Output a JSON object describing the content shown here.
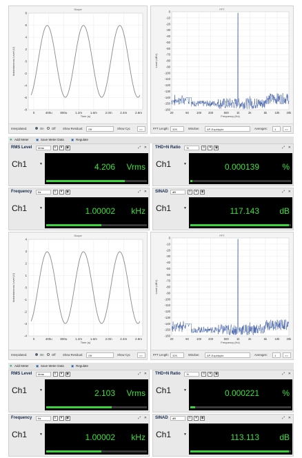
{
  "panels": [
    {
      "scope": {
        "title": "Scope",
        "ylabel": "Instantaneous Level (V)",
        "xlabel": "Time (s)",
        "yticks": [
          "8",
          "6",
          "4",
          "2",
          "0",
          "-2",
          "-4",
          "-6",
          "-8"
        ],
        "xticks": [
          "0",
          "400u",
          "800u",
          "1.2m",
          "1.6m",
          "2.0m",
          "2.4m",
          "2.8m"
        ],
        "amplitude": 5.95,
        "controls": {
          "interpolated": "Interpolated:",
          "on": "On",
          "off": "Off",
          "show_residual": "Show Residual:",
          "residual_value": "Off",
          "show_cyc": "Show Cyc",
          "more": ">>"
        }
      },
      "fft": {
        "title": "FFT",
        "ylabel": "Level (dBV)",
        "xlabel": "Frequency (Hz)",
        "yticks": [
          "0",
          "-10",
          "-20",
          "-30",
          "-40",
          "-50",
          "-60",
          "-70",
          "-80",
          "-90",
          "-100",
          "-110",
          "-120",
          "-130",
          "-140",
          "-150",
          "-160"
        ],
        "xticks": [
          "20",
          "50",
          "100",
          "200",
          "500",
          "1k",
          "2k",
          "5k",
          "10k",
          "20k"
        ],
        "controls": {
          "length_label": "FFT Length:",
          "length": "32K",
          "window_label": "Window:",
          "window": "AP-Equiripple",
          "avg_label": "Averages:",
          "avg": "1",
          "more": ">>"
        }
      },
      "toolbar": {
        "add": "Add Meter",
        "save": "Save Meter Data",
        "regulate": "Regulate"
      },
      "meters": [
        {
          "title": "RMS Level",
          "unit_select": "Vrms",
          "channel": "Ch1",
          "value": "4.206",
          "unit": "Vrms",
          "bar_fraction": 0.78
        },
        {
          "title": "THD+N Ratio",
          "unit_select": "%",
          "channel": "Ch1",
          "value": "0.000139",
          "unit": "%",
          "bar_fraction": 0.02
        },
        {
          "title": "Frequency",
          "unit_select": "Hz",
          "channel": "Ch1",
          "value": "1.00002",
          "unit": "kHz",
          "bar_fraction": 0.55
        },
        {
          "title": "SINAD",
          "unit_select": "dB",
          "channel": "Ch1",
          "value": "117.143",
          "unit": "dB",
          "bar_fraction": 0.98
        }
      ]
    },
    {
      "scope": {
        "title": "Scope",
        "ylabel": "Instantaneous Level (V)",
        "xlabel": "Time (s)",
        "yticks": [
          "4",
          "3",
          "2",
          "1",
          "0",
          "-1",
          "-2",
          "-3",
          "-4"
        ],
        "xticks": [
          "0",
          "400u",
          "800u",
          "1.2m",
          "1.6m",
          "2.0m",
          "2.4m",
          "2.8m"
        ],
        "amplitude": 2.97,
        "controls": {
          "interpolated": "Interpolated:",
          "on": "On",
          "off": "Off",
          "show_residual": "Show Residual:",
          "residual_value": "Off",
          "show_cyc": "Show Cyc",
          "more": ">>"
        }
      },
      "fft": {
        "title": "FFT",
        "ylabel": "Level (dBV)",
        "xlabel": "Frequency (Hz)",
        "yticks": [
          "0",
          "-10",
          "-20",
          "-30",
          "-40",
          "-50",
          "-60",
          "-70",
          "-80",
          "-90",
          "-100",
          "-110",
          "-120",
          "-130",
          "-140",
          "-150",
          "-160"
        ],
        "xticks": [
          "20",
          "50",
          "100",
          "200",
          "500",
          "1k",
          "2k",
          "5k",
          "10k",
          "20k"
        ],
        "controls": {
          "length_label": "FFT Length:",
          "length": "32K",
          "window_label": "Window:",
          "window": "AP-Equiripple",
          "avg_label": "Averages:",
          "avg": "1",
          "more": ">>"
        }
      },
      "toolbar": {
        "add": "Add Meter",
        "save": "Save Meter Data",
        "regulate": "Regulate"
      },
      "meters": [
        {
          "title": "RMS Level",
          "unit_select": "Vrms",
          "channel": "Ch1",
          "value": "2.103",
          "unit": "Vrms",
          "bar_fraction": 0.65
        },
        {
          "title": "THD+N Ratio",
          "unit_select": "%",
          "channel": "Ch1",
          "value": "0.000221",
          "unit": "%",
          "bar_fraction": 0.05
        },
        {
          "title": "Frequency",
          "unit_select": "Hz",
          "channel": "Ch1",
          "value": "1.00002",
          "unit": "kHz",
          "bar_fraction": 0.55
        },
        {
          "title": "SINAD",
          "unit_select": "dB",
          "channel": "Ch1",
          "value": "113.113",
          "unit": "dB",
          "bar_fraction": 0.98
        }
      ]
    }
  ],
  "colors": {
    "signal": "#888888",
    "fft": "#2e4f9e",
    "display": "#000000",
    "digits": "#3ce03c"
  }
}
